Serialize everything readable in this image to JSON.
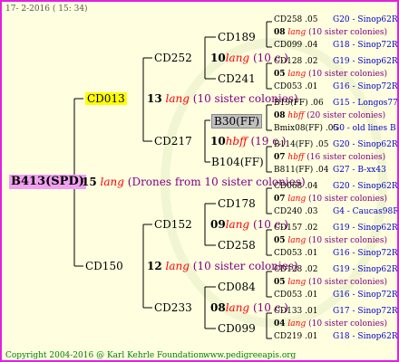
{
  "header": {
    "date": "17- 2-2016 ( 15: 34)"
  },
  "footer": {
    "copyright": "Copyright 2004-2016 @ Karl Kehrle Foundation.",
    "url": "www.pedigreeapis.org"
  },
  "colors": {
    "border": "#e020e0",
    "background": "#ffffe0",
    "lines": "#000000",
    "accent_red": "#ff0000",
    "text_purple": "#800080",
    "link_blue": "#0000cc"
  },
  "tree": {
    "root": {
      "name": "B413(SPD)"
    },
    "g1": {
      "num": "15",
      "lang": "lang",
      "note": "(Drones from 10 sister colonies)"
    },
    "p1": {
      "name": "CD013",
      "num": "13",
      "lang": "lang",
      "note": "(10 sister colonies)"
    },
    "p2": {
      "name": "CD150",
      "num": "12",
      "lang": "lang",
      "note": "(10 sister colonies)"
    },
    "p1a": {
      "name": "CD252",
      "num": "10",
      "lang": "lang",
      "note": "(10 c.)"
    },
    "p1b": {
      "name": "CD217",
      "num": "10",
      "lang": "hbff",
      "note": "(19 c.)"
    },
    "p2a": {
      "name": "CD152",
      "num": "09",
      "lang": "lang",
      "note": "(10 c.)"
    },
    "p2b": {
      "name": "CD233",
      "num": "08",
      "lang": "lang",
      "note": "(10 c.)"
    },
    "l3": [
      {
        "name": "CD189"
      },
      {
        "name": "CD241"
      },
      {
        "name": "B30(FF)"
      },
      {
        "name": "B104(FF)"
      },
      {
        "name": "CD178"
      },
      {
        "name": "CD258"
      },
      {
        "name": "CD084"
      },
      {
        "name": "CD099"
      }
    ],
    "l4": [
      {
        "a": "CD258 .05",
        "as": "G20 - Sinop62R",
        "num": "08",
        "lang": "lang",
        "note": "(10 sister colonies)",
        "b": "CD099 .04",
        "bs": "G18 - Sinop72R"
      },
      {
        "a": "CD128 .02",
        "as": "G19 - Sinop62R",
        "num": "05",
        "lang": "lang",
        "note": "(10 sister colonies)",
        "b": "CD053 .01",
        "bs": "G16 - Sinop72R"
      },
      {
        "a": "B19(FF) .06",
        "as": "G15 - Longos77R",
        "num": "08",
        "lang": "hbff",
        "note": "(20 sister colonies)",
        "b": "Bmix08(FF) .05",
        "bs": "G0 - old lines B"
      },
      {
        "a": "B114(FF) .05",
        "as": "G20 - Sinop62R",
        "num": "07",
        "lang": "hbff",
        "note": "(16 sister colonies)",
        "b": "B811(FF) .04",
        "bs": "G27 - B-xx43"
      },
      {
        "a": "CD068 .04",
        "as": "G20 - Sinop62R",
        "num": "07",
        "lang": "lang",
        "note": "(10 sister colonies)",
        "b": "CD240 .03",
        "bs": "G4 - Caucas98R"
      },
      {
        "a": "CD157 .02",
        "as": "G19 - Sinop62R",
        "num": "05",
        "lang": "lang",
        "note": "(10 sister colonies)",
        "b": "CD053 .01",
        "bs": "G16 - Sinop72R"
      },
      {
        "a": "CD128 .02",
        "as": "G19 - Sinop62R",
        "num": "05",
        "lang": "lang",
        "note": "(10 sister colonies)",
        "b": "CD053 .01",
        "bs": "G16 - Sinop72R"
      },
      {
        "a": "CD133 .01",
        "as": "G17 - Sinop72R",
        "num": "04",
        "lang": "lang",
        "note": "(10 sister colonies)",
        "b": "CD219 .01",
        "bs": "G18 - Sinop62R"
      }
    ]
  }
}
